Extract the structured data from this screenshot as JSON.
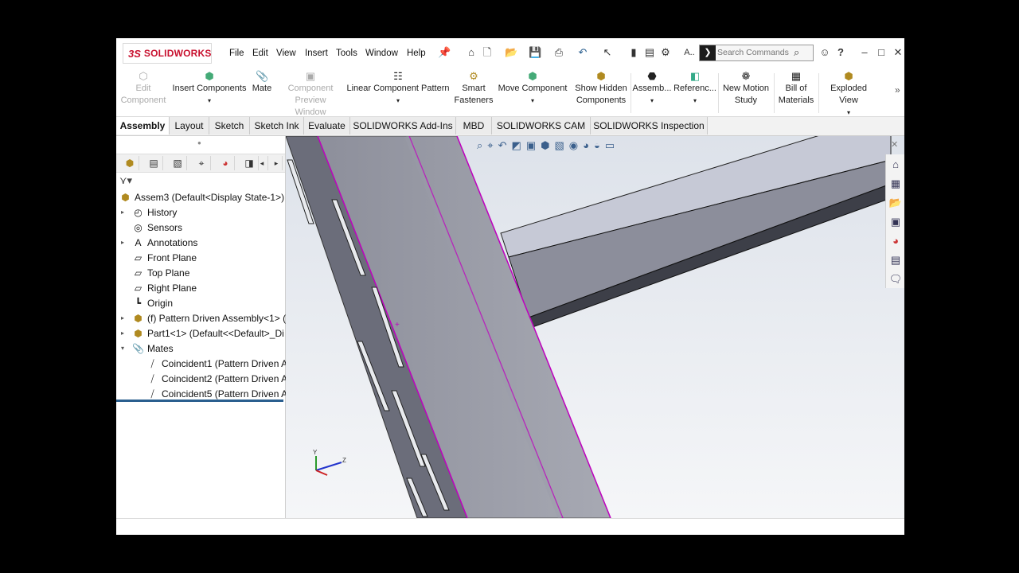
{
  "app": {
    "logo_ds": "3S",
    "logo_text": "SOLIDWORKS"
  },
  "menu": [
    "File",
    "Edit",
    "View",
    "Insert",
    "Tools",
    "Window",
    "Help"
  ],
  "search": {
    "placeholder": "Search Commands"
  },
  "ribbon": {
    "edit_component": [
      "Edit",
      "Component"
    ],
    "insert_components": "Insert Components",
    "mate": "Mate",
    "component_preview": [
      "Component",
      "Preview Window"
    ],
    "linear_pattern": "Linear Component Pattern",
    "smart_fasteners": [
      "Smart",
      "Fasteners"
    ],
    "move_component": "Move Component",
    "show_hidden": [
      "Show Hidden",
      "Components"
    ],
    "assembly": "Assemb...",
    "reference": "Referenc...",
    "new_motion": [
      "New Motion",
      "Study"
    ],
    "bom": [
      "Bill of",
      "Materials"
    ],
    "exploded": "Exploded View",
    "more": "»"
  },
  "tabs": [
    "Assembly",
    "Layout",
    "Sketch",
    "Sketch Ink",
    "Evaluate",
    "SOLIDWORKS Add-Ins",
    "MBD",
    "SOLIDWORKS CAM",
    "SOLIDWORKS Inspection"
  ],
  "tree": [
    {
      "label": "Assem3  (Default<Display State-1>)",
      "icon": "assembly-icon"
    },
    {
      "label": "History",
      "icon": "history-icon"
    },
    {
      "label": "Sensors",
      "icon": "sensor-icon"
    },
    {
      "label": "Annotations",
      "icon": "annotation-icon"
    },
    {
      "label": "Front Plane",
      "icon": "plane-icon"
    },
    {
      "label": "Top Plane",
      "icon": "plane-icon"
    },
    {
      "label": "Right Plane",
      "icon": "plane-icon"
    },
    {
      "label": "Origin",
      "icon": "origin-icon"
    },
    {
      "label": "(f) Pattern Driven Assembly<1> (I",
      "icon": "subassembly-icon"
    },
    {
      "label": "Part1<1> (Default<<Default>_Di",
      "icon": "part-icon"
    },
    {
      "label": "Mates",
      "icon": "mates-icon"
    },
    {
      "label": "Coincident1 (Pattern Driven A",
      "icon": "coincident-icon"
    },
    {
      "label": "Coincident2 (Pattern Driven A",
      "icon": "coincident-icon"
    },
    {
      "label": "Coincident5 (Pattern Driven A",
      "icon": "coincident-icon"
    }
  ],
  "triad": {
    "y": "Y",
    "z": "Z"
  },
  "colors": {
    "accent": "#2a5f8f",
    "brand": "#c8102e",
    "highlight": "#c000c0",
    "steel_dark": "#6b6d7a",
    "steel_face": "#9fa1ab",
    "bg": "#e9ecf1"
  }
}
